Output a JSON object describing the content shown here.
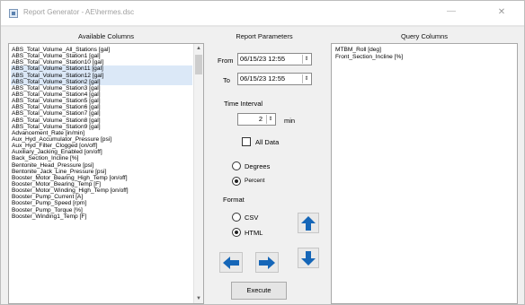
{
  "window": {
    "title": "Report Generator - AE\\hermes.dsc",
    "minimize_glyph": "—",
    "close_glyph": "✕"
  },
  "headers": {
    "available": "Available Columns",
    "params": "Report Parameters",
    "query": "Query Columns"
  },
  "available_columns": [
    "ABS_Total_Volume_All_Stations [gal]",
    "ABS_Total_Volume_Station1 [gal]",
    "ABS_Total_Volume_Station10 [gal]",
    "ABS_Total_Volume_Station11 [gal]",
    "ABS_Total_Volume_Station12 [gal]",
    "ABS_Total_Volume_Station2 [gal]",
    "ABS_Total_Volume_Station3 [gal]",
    "ABS_Total_Volume_Station4 [gal]",
    "ABS_Total_Volume_Station5 [gal]",
    "ABS_Total_Volume_Station6 [gal]",
    "ABS_Total_Volume_Station7 [gal]",
    "ABS_Total_Volume_Station8 [gal]",
    "ABS_Total_Volume_Station9 [gal]",
    "Advancement_Rate [in/min]",
    "Aux_Hyd_Accumulator_Pressure [psi]",
    "Aux_Hyd_Filter_Clogged [on/off]",
    "Auxiliary_Jacking_Enabled [on/off]",
    "Back_Section_Incline [%]",
    "Bentonite_Head_Pressure [psi]",
    "Bentonite_Jack_Line_Pressure [psi]",
    "Booster_Motor_Bearing_High_Temp [on/off]",
    "Booster_Motor_Bearing_Temp [F]",
    "Booster_Motor_Winding_High_Temp [on/off]",
    "Booster_Pump_Current [A]",
    "Booster_Pump_Speed [rpm]",
    "Booster_Pump_Torque [%]",
    "Booster_Winding1_Temp [F]"
  ],
  "query_columns": [
    "MTBM_Roll [deg]",
    "Front_Section_Incline [%]"
  ],
  "params": {
    "from_label": "From",
    "from_value": "06/15/23 12:55",
    "to_label": "To",
    "to_value": "06/15/23 12:55",
    "time_interval_label": "Time Interval",
    "interval_value": "2",
    "interval_unit": "min",
    "all_data_label": "All Data",
    "all_data_checked": false,
    "units_options": [
      "Degrees",
      "Percent"
    ],
    "units_selected": "Percent",
    "format_label": "Format",
    "format_options": [
      "CSV",
      "HTML"
    ],
    "format_selected": "HTML",
    "execute_label": "Execute"
  },
  "colors": {
    "arrow_blue": "#1566b8",
    "selection": "#dbe8f7",
    "window_bg": "#f0f0f0"
  },
  "icons": {
    "move_up": "arrow-up-icon",
    "move_down": "arrow-down-icon",
    "move_left": "arrow-left-icon",
    "move_right": "arrow-right-icon"
  }
}
